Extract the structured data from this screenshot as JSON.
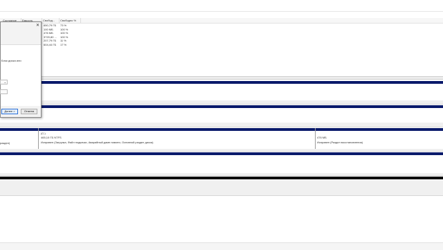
{
  "table": {
    "headers": [
      "Состояние",
      "Емкость",
      "Свобод...",
      "Свободно %"
    ],
    "rows": [
      {
        "free": "650,79 ГБ",
        "pct": "73 %"
      },
      {
        "free": "100 МБ",
        "pct": "100 %"
      },
      {
        "free": "476 МБ",
        "pct": "100 %"
      },
      {
        "free": "3720,80 ...",
        "pct": "100 %"
      },
      {
        "free": "207,79 ГБ",
        "pct": "11 %"
      },
      {
        "free": "604,44 ГБ",
        "pct": "17 %"
      }
    ]
  },
  "dialog": {
    "text": "Блок диска или",
    "next_label": "Далее >",
    "cancel_label": "Отмена"
  },
  "disk": {
    "left_partition_status": "раздел)",
    "main_partition": {
      "label": "(C:)",
      "size": "465,10 ГБ NTFS",
      "status": "Исправен (Загрузка, Файл подкачки, Аварийный дамп памяти, Основной раздел диска)"
    },
    "recovery_partition": {
      "size": "476 МБ",
      "status": "Исправен (Раздел восстановления)"
    }
  },
  "colors": {
    "primary_partition_bar": "#0a1a6b",
    "unallocated_bar": "#0a0a0a",
    "dialog_primary_button_border": "#2b6fd6"
  }
}
